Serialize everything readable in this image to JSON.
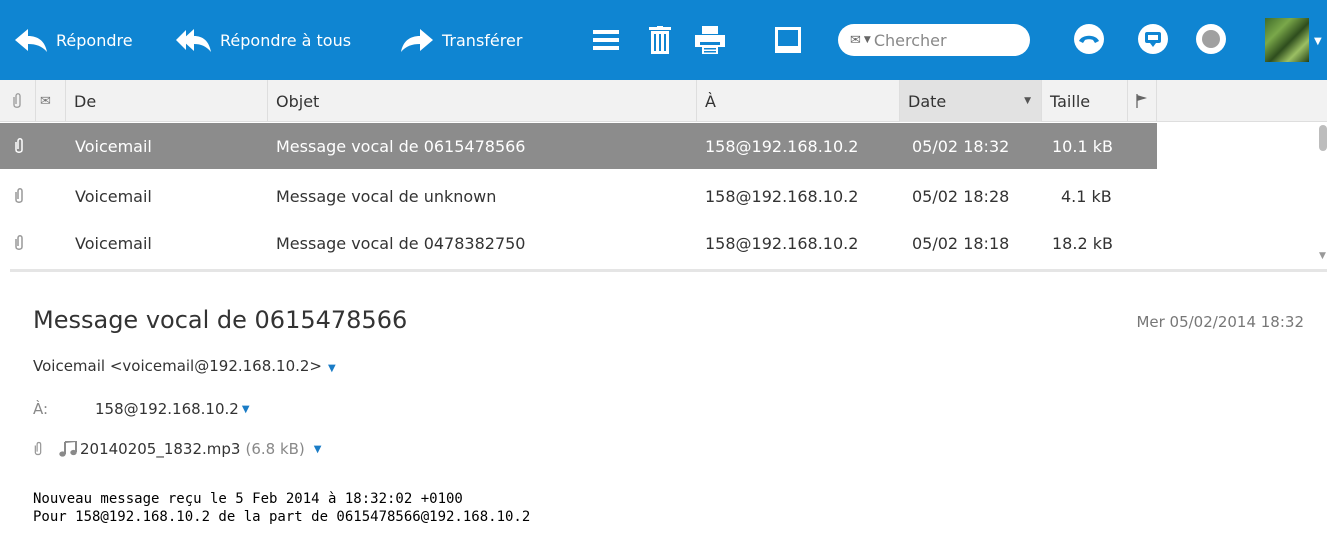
{
  "toolbar": {
    "reply_label": "Répondre",
    "reply_all_label": "Répondre à tous",
    "forward_label": "Transférer",
    "search_placeholder": "Chercher",
    "menu_icon": "menu-icon",
    "delete_icon": "trash-icon",
    "print_icon": "printer-icon",
    "window_icon": "window-icon",
    "accent_color": "#0f85d2"
  },
  "list": {
    "columns": {
      "attachment": "",
      "flag": "",
      "from": "De",
      "subject": "Objet",
      "to": "À",
      "date": "Date",
      "size": "Taille"
    },
    "sorted_by": "date",
    "sort_direction": "descending",
    "rows": [
      {
        "from": "Voicemail",
        "subject": "Message vocal de 0615478566",
        "to": "158@192.168.10.2",
        "date": "05/02 18:32",
        "size": "10.1 kB",
        "selected": true
      },
      {
        "from": "Voicemail",
        "subject": "Message vocal de unknown",
        "to": "158@192.168.10.2",
        "date": "05/02 18:28",
        "size": "4.1 kB",
        "selected": false
      },
      {
        "from": "Voicemail",
        "subject": "Message vocal de 0478382750",
        "to": "158@192.168.10.2",
        "date": "05/02 18:18",
        "size": "18.2 kB",
        "selected": false
      }
    ]
  },
  "preview": {
    "subject": "Message vocal de 0615478566",
    "date": "Mer 05/02/2014 18:32",
    "from": "Voicemail <voicemail@192.168.10.2>",
    "to_label": "À:",
    "to": "158@192.168.10.2",
    "attachment_name": "20140205_1832.mp3",
    "attachment_size": "(6.8 kB)",
    "body_line1": "Nouveau message reçu le 5 Feb 2014 à 18:32:02 +0100",
    "body_line2": "Pour 158@192.168.10.2 de la part de 0615478566@192.168.10.2"
  }
}
